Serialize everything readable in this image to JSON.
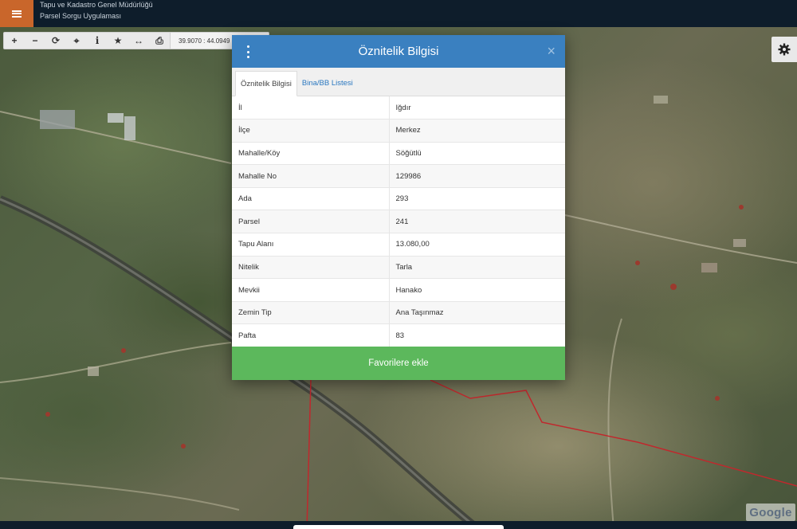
{
  "header": {
    "org_name": "Tapu ve Kadastro Genel Müdürlüğü",
    "app_name": "Parsel Sorgu Uygulaması",
    "menu_icon": "hamburger-icon",
    "accent_color": "#c9662b"
  },
  "toolbar": {
    "tools": [
      {
        "name": "zoom-in",
        "glyph": "+"
      },
      {
        "name": "zoom-out",
        "glyph": "−"
      },
      {
        "name": "refresh",
        "glyph": "⟳"
      },
      {
        "name": "locate",
        "glyph": "⌖"
      },
      {
        "name": "info",
        "glyph": "i"
      },
      {
        "name": "favorite",
        "glyph": "★"
      },
      {
        "name": "measure",
        "glyph": "↔"
      },
      {
        "name": "print",
        "glyph": "⎙"
      }
    ],
    "coordinates": "39.9070 : 44.0949"
  },
  "modal": {
    "title": "Öznitelik Bilgisi",
    "close_glyph": "×",
    "header_color": "#3a80c0",
    "tabs": [
      {
        "label": "Öznitelik Bilgisi",
        "active": true
      },
      {
        "label": "Bina/BB Listesi",
        "active": false
      }
    ],
    "rows": [
      {
        "key": "İl",
        "value": "Iğdır"
      },
      {
        "key": "İlçe",
        "value": "Merkez"
      },
      {
        "key": "Mahalle/Köy",
        "value": "Söğütlü"
      },
      {
        "key": "Mahalle No",
        "value": "129986"
      },
      {
        "key": "Ada",
        "value": "293"
      },
      {
        "key": "Parsel",
        "value": "241"
      },
      {
        "key": "Tapu Alanı",
        "value": "13.080,00"
      },
      {
        "key": "Nitelik",
        "value": "Tarla"
      },
      {
        "key": "Mevkii",
        "value": "Hanako"
      },
      {
        "key": "Zemin Tip",
        "value": "Ana Taşınmaz"
      },
      {
        "key": "Pafta",
        "value": "83"
      }
    ],
    "favorite_button": "Favorilere ekle",
    "favorite_color": "#5cb85c"
  },
  "map": {
    "attribution": "Google",
    "settings_icon": "gear-icon"
  }
}
